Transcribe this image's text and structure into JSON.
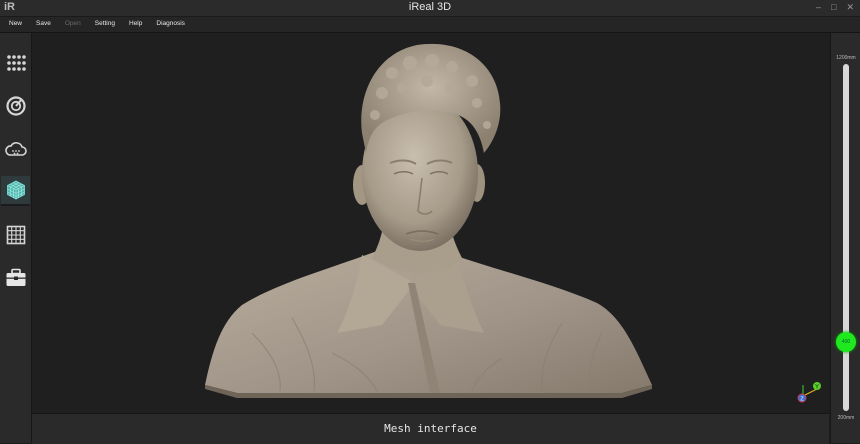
{
  "window": {
    "logo": "iR",
    "title": "iReal 3D",
    "controls": [
      "–",
      "□",
      "✕"
    ]
  },
  "menu": {
    "new": "New",
    "save": "Save",
    "open": "Open",
    "setting": "Setting",
    "help": "Help",
    "diagnosis": "Diagnosis"
  },
  "sidebar": {
    "items": [
      {
        "icon": "grid-dots-icon",
        "active": false
      },
      {
        "icon": "scan-target-icon",
        "active": false
      },
      {
        "icon": "cloud-icon",
        "active": false
      },
      {
        "icon": "mesh-cube-icon",
        "active": true
      },
      {
        "icon": "grid-icon",
        "active": false
      },
      {
        "icon": "toolbox-icon",
        "active": false
      }
    ]
  },
  "status": {
    "text": "Mesh interface"
  },
  "slider": {
    "max_label": "1200mm",
    "min_label": "200mm",
    "min": 200,
    "max": 1200,
    "value": 400,
    "value_label": "400",
    "knob_color": "#1fe81f"
  },
  "axis_gizmo": {
    "y_label": "Y",
    "z_label": "Z"
  }
}
